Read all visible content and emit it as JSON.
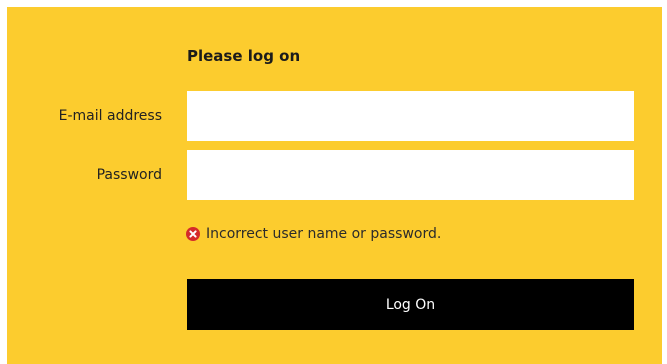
{
  "form": {
    "title": "Please log on",
    "email_label": "E-mail address",
    "email_value": "",
    "password_label": "Password",
    "password_value": "",
    "error_icon": "error-circle-x-icon",
    "error_message": "Incorrect user name or password.",
    "submit_label": "Log On"
  },
  "colors": {
    "panel_background": "#fccc2e",
    "input_background": "#ffffff",
    "button_background": "#000000",
    "button_text": "#ffffff",
    "error_icon": "#d42a2a"
  }
}
